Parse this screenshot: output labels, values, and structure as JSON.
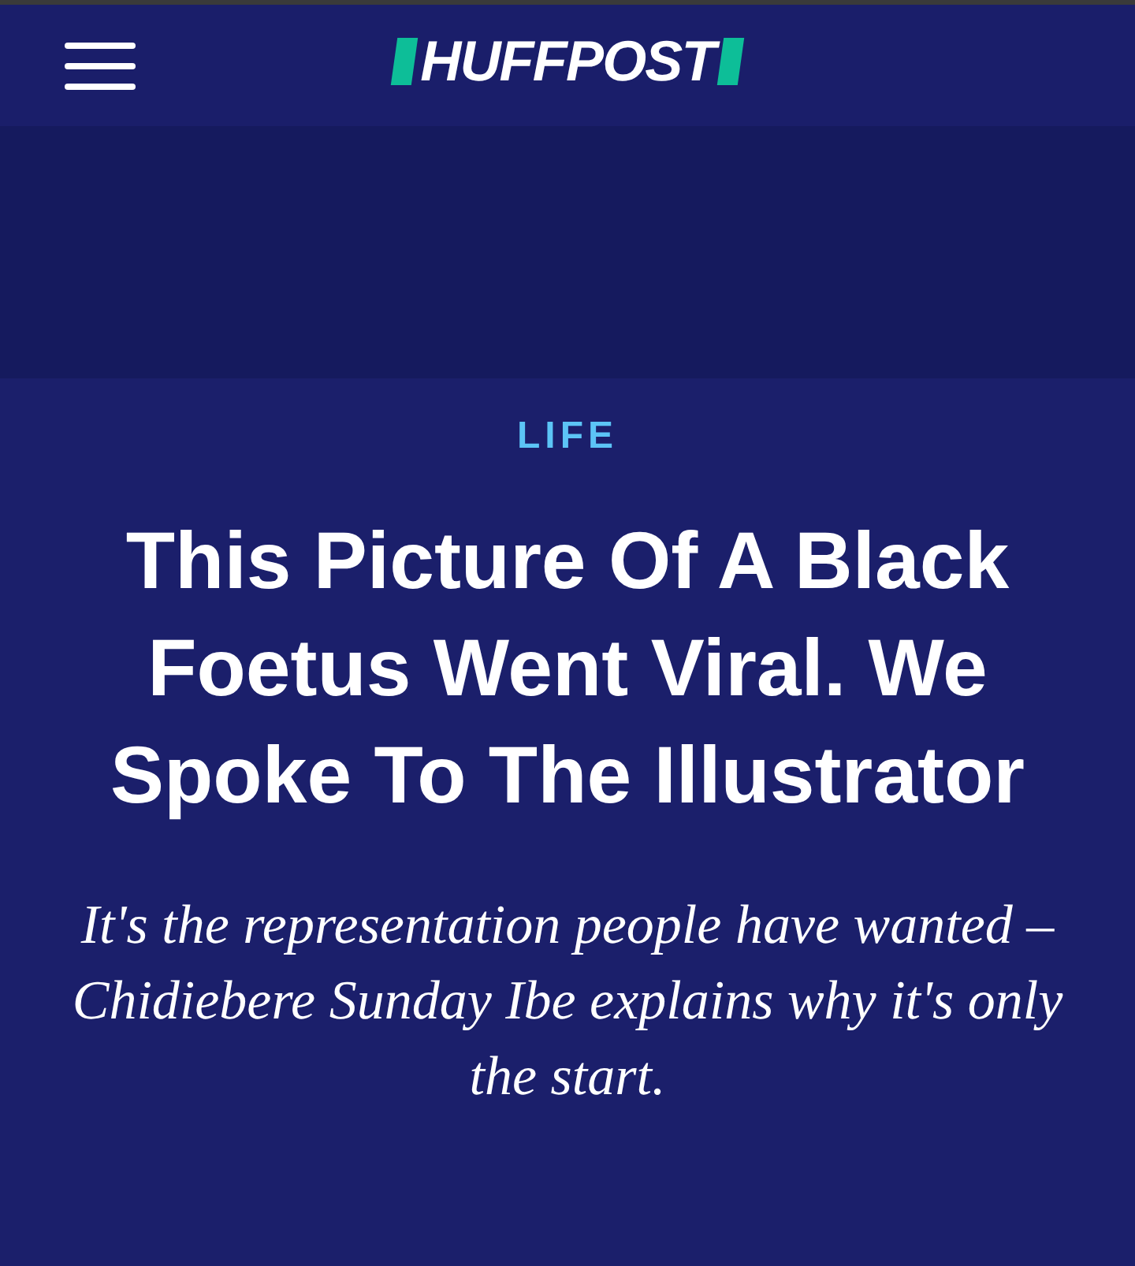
{
  "header": {
    "logo": "HUFFPOST"
  },
  "article": {
    "category": "LIFE",
    "headline": "This Picture Of A Black Foetus Went Viral. We Spoke To The Illustrator",
    "subtitle": "It's the representation people have wanted – Chidiebere Sunday Ibe explains why it's only the start."
  }
}
